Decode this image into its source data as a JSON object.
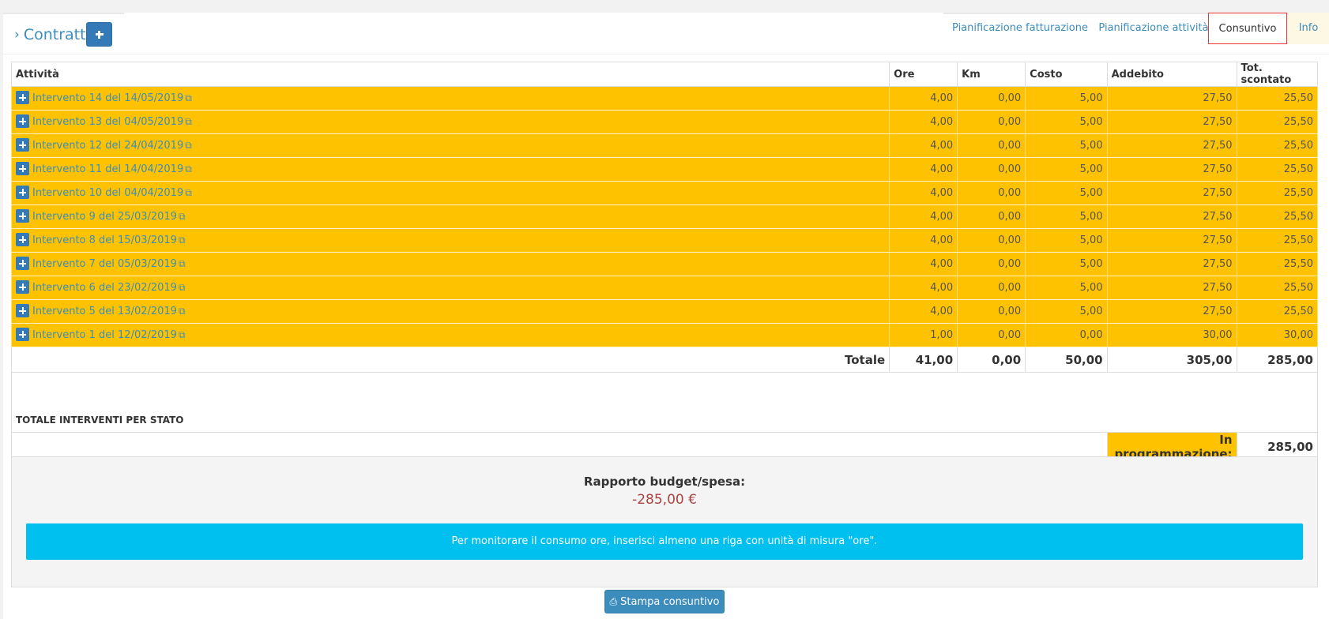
{
  "header": {
    "title": "Contratti",
    "add_button": "+",
    "tabs": [
      {
        "label": "Pianificazione fatturazione"
      },
      {
        "label": "Pianificazione attività"
      },
      {
        "label": "Consuntivo"
      },
      {
        "label": "Info"
      }
    ]
  },
  "table": {
    "columns": [
      "Attività",
      "Ore",
      "Km",
      "Costo",
      "Addebito",
      "Tot. scontato"
    ],
    "rows": [
      {
        "name": "Intervento 14 del 14/05/2019",
        "ore": "4,00",
        "km": "0,00",
        "costo": "5,00",
        "addebito": "27,50",
        "tot": "25,50"
      },
      {
        "name": "Intervento 13 del 04/05/2019",
        "ore": "4,00",
        "km": "0,00",
        "costo": "5,00",
        "addebito": "27,50",
        "tot": "25,50"
      },
      {
        "name": "Intervento 12 del 24/04/2019",
        "ore": "4,00",
        "km": "0,00",
        "costo": "5,00",
        "addebito": "27,50",
        "tot": "25,50"
      },
      {
        "name": "Intervento 11 del 14/04/2019",
        "ore": "4,00",
        "km": "0,00",
        "costo": "5,00",
        "addebito": "27,50",
        "tot": "25,50"
      },
      {
        "name": "Intervento 10 del 04/04/2019",
        "ore": "4,00",
        "km": "0,00",
        "costo": "5,00",
        "addebito": "27,50",
        "tot": "25,50"
      },
      {
        "name": "Intervento 9 del 25/03/2019",
        "ore": "4,00",
        "km": "0,00",
        "costo": "5,00",
        "addebito": "27,50",
        "tot": "25,50"
      },
      {
        "name": "Intervento 8 del 15/03/2019",
        "ore": "4,00",
        "km": "0,00",
        "costo": "5,00",
        "addebito": "27,50",
        "tot": "25,50"
      },
      {
        "name": "Intervento 7 del 05/03/2019",
        "ore": "4,00",
        "km": "0,00",
        "costo": "5,00",
        "addebito": "27,50",
        "tot": "25,50"
      },
      {
        "name": "Intervento 6 del 23/02/2019",
        "ore": "4,00",
        "km": "0,00",
        "costo": "5,00",
        "addebito": "27,50",
        "tot": "25,50"
      },
      {
        "name": "Intervento 5 del 13/02/2019",
        "ore": "4,00",
        "km": "0,00",
        "costo": "5,00",
        "addebito": "27,50",
        "tot": "25,50"
      },
      {
        "name": "Intervento 1 del 12/02/2019",
        "ore": "1,00",
        "km": "0,00",
        "costo": "0,00",
        "addebito": "30,00",
        "tot": "30,00"
      }
    ],
    "totals": {
      "label": "Totale",
      "ore": "41,00",
      "km": "0,00",
      "costo": "50,00",
      "addebito": "305,00",
      "tot": "285,00"
    },
    "stato_heading": "TOTALE INTERVENTI PER STATO",
    "stato_rows": [
      {
        "label": "In programmazione:",
        "value": "285,00",
        "color": "#fec200"
      }
    ]
  },
  "budget": {
    "title": "Rapporto budget/spesa:",
    "value": "-285,00 €",
    "alert": "Per monitorare il consumo ore, inserisci almeno una riga con unità di misura \"ore\"."
  },
  "print_button": "Stampa consuntivo",
  "icons": {
    "expand": "plus-square-icon",
    "external": "external-link-icon",
    "printer": "printer-icon",
    "chevron": "chevron-right-icon"
  },
  "colors": {
    "accent": "#3c8dbc",
    "row_highlight": "#fec200",
    "alert": "#00c0ef",
    "negative": "#a94442"
  }
}
